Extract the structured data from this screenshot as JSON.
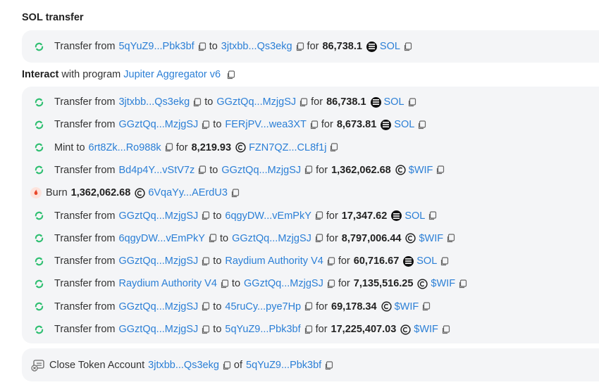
{
  "section_title": "SOL transfer",
  "sol_transfer": {
    "verb": "Transfer from",
    "from": "5qYuZ9...Pbk3bf",
    "to_word": "to",
    "to": "3jtxbb...Qs3ekg",
    "for_word": "for",
    "amount": "86,738.1",
    "token": "SOL"
  },
  "interact": {
    "label": "Interact",
    "middle": "with program",
    "program": "Jupiter Aggregator v6"
  },
  "rows": [
    {
      "type": "transfer",
      "verb": "Transfer from",
      "from": "3jtxbb...Qs3ekg",
      "to_word": "to",
      "to": "GGztQq...MzjgSJ",
      "for_word": "for",
      "amount": "86,738.1",
      "token": "SOL",
      "token_kind": "sol",
      "icon": "refresh-icon"
    },
    {
      "type": "transfer",
      "verb": "Transfer from",
      "from": "GGztQq...MzjgSJ",
      "to_word": "to",
      "to": "FERjPV...wea3XT",
      "for_word": "for",
      "amount": "8,673.81",
      "token": "SOL",
      "token_kind": "sol",
      "icon": "refresh-icon"
    },
    {
      "type": "mint",
      "verb": "Mint to",
      "to": "6rt8Zk...Ro988k",
      "for_word": "for",
      "amount": "8,219.93",
      "token": "FZN7QZ...CL8f1j",
      "token_kind": "c",
      "icon": "refresh-icon"
    },
    {
      "type": "transfer",
      "verb": "Transfer from",
      "from": "Bd4p4Y...vStV7z",
      "to_word": "to",
      "to": "GGztQq...MzjgSJ",
      "for_word": "for",
      "amount": "1,362,062.68",
      "token": "$WIF",
      "token_kind": "c",
      "icon": "refresh-icon"
    },
    {
      "type": "burn",
      "verb": "Burn",
      "amount": "1,362,062.68",
      "token": "6VqaYy...AErdU3",
      "token_kind": "c",
      "icon": "fire-icon"
    },
    {
      "type": "transfer",
      "verb": "Transfer from",
      "from": "GGztQq...MzjgSJ",
      "to_word": "to",
      "to": "6qgyDW...vEmPkY",
      "for_word": "for",
      "amount": "17,347.62",
      "token": "SOL",
      "token_kind": "sol",
      "icon": "refresh-icon"
    },
    {
      "type": "transfer",
      "verb": "Transfer from",
      "from": "6qgyDW...vEmPkY",
      "to_word": "to",
      "to": "GGztQq...MzjgSJ",
      "for_word": "for",
      "amount": "8,797,006.44",
      "token": "$WIF",
      "token_kind": "c",
      "icon": "refresh-icon"
    },
    {
      "type": "transfer",
      "verb": "Transfer from",
      "from": "GGztQq...MzjgSJ",
      "to_word": "to",
      "to": "Raydium Authority V4",
      "for_word": "for",
      "amount": "60,716.67",
      "token": "SOL",
      "token_kind": "sol",
      "icon": "refresh-icon"
    },
    {
      "type": "transfer",
      "verb": "Transfer from",
      "from": "Raydium Authority V4",
      "to_word": "to",
      "to": "GGztQq...MzjgSJ",
      "for_word": "for",
      "amount": "7,135,516.25",
      "token": "$WIF",
      "token_kind": "c",
      "icon": "refresh-icon"
    },
    {
      "type": "transfer",
      "verb": "Transfer from",
      "from": "GGztQq...MzjgSJ",
      "to_word": "to",
      "to": "45ruCy...pye7Hp",
      "for_word": "for",
      "amount": "69,178.34",
      "token": "$WIF",
      "token_kind": "c",
      "icon": "refresh-icon"
    },
    {
      "type": "transfer",
      "verb": "Transfer from",
      "from": "GGztQq...MzjgSJ",
      "to_word": "to",
      "to": "5qYuZ9...Pbk3bf",
      "for_word": "for",
      "amount": "17,225,407.03",
      "token": "$WIF",
      "token_kind": "c",
      "icon": "refresh-icon"
    }
  ],
  "close_account": {
    "verb": "Close Token Account",
    "account": "3jtxbb...Qs3ekg",
    "of_word": "of",
    "owner": "5qYuZ9...Pbk3bf",
    "icon": "close-account-icon"
  },
  "colors": {
    "link": "#2b7fd6",
    "panel_bg": "#f4f5f7",
    "refresh_icon": "#2fbf71",
    "fire_bg": "#fde3dc",
    "fire": "#e8462a"
  }
}
